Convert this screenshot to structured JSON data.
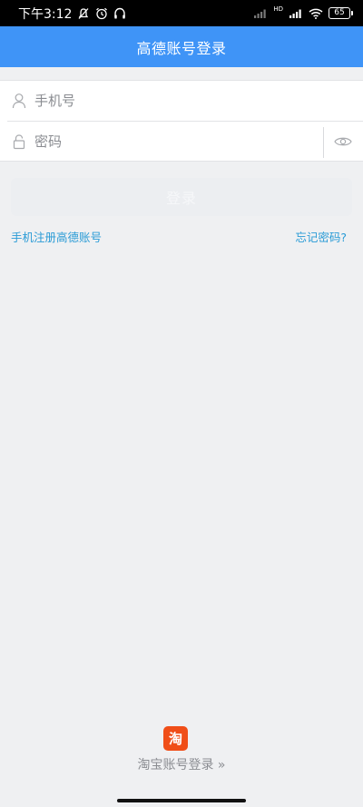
{
  "status_bar": {
    "time": "下午3:12",
    "network_badge": "HD",
    "battery": "65"
  },
  "header": {
    "title": "高德账号登录"
  },
  "form": {
    "phone_placeholder": "手机号",
    "password_placeholder": "密码",
    "icons": {
      "phone": "user-icon",
      "password": "lock-icon",
      "toggle": "eye-icon"
    }
  },
  "actions": {
    "login_label": "登录",
    "register_link": "手机注册高德账号",
    "forgot_link": "忘记密码?"
  },
  "footer": {
    "taobao_logo_text": "淘",
    "taobao_login": "淘宝账号登录 »"
  },
  "colors": {
    "header_bg": "#3f94f7",
    "link": "#2a9bd6",
    "taobao": "#f04e18",
    "page_bg": "#eff0f2"
  }
}
